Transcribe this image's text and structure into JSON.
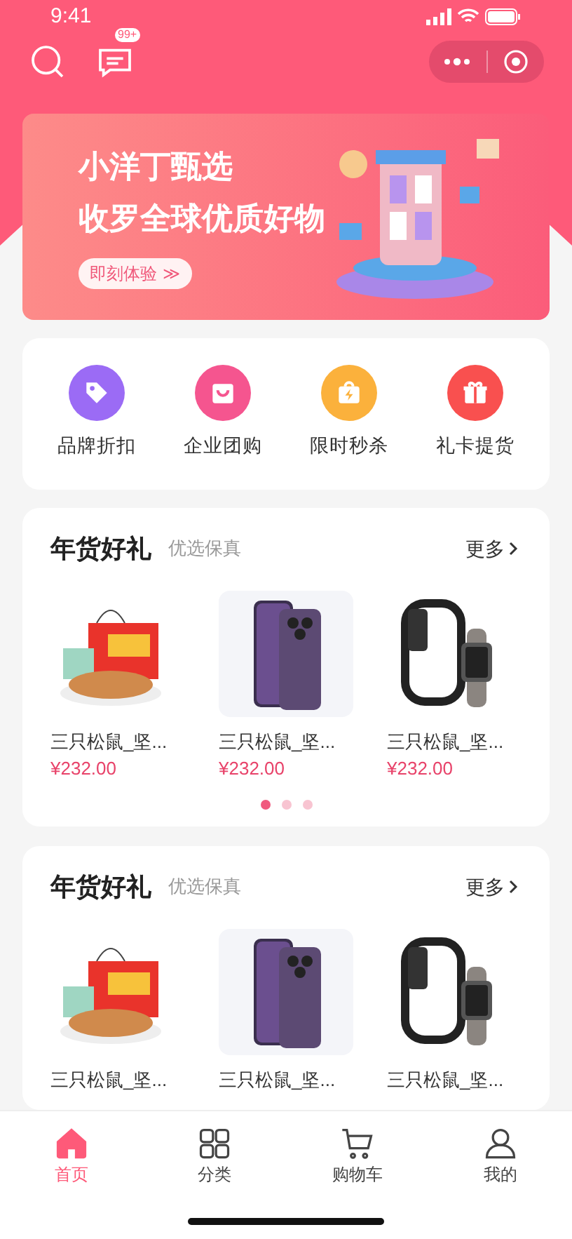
{
  "status_bar": {
    "time": "9:41"
  },
  "header": {
    "message_badge": "99+"
  },
  "banner": {
    "title": "小洋丁甄选",
    "subtitle": "收罗全球优质好物",
    "button": "即刻体验",
    "button_icon": "≫"
  },
  "shortcuts": [
    {
      "label": "品牌折扣",
      "kind": "tag",
      "color": "#9b6bf5"
    },
    {
      "label": "企业团购",
      "kind": "bag",
      "color": "#f5558f"
    },
    {
      "label": "限时秒杀",
      "kind": "flash",
      "color": "#fbb13c"
    },
    {
      "label": "礼卡提货",
      "kind": "gift",
      "color": "#f9504f"
    }
  ],
  "sections": [
    {
      "title": "年货好礼",
      "subtitle": "优选保真",
      "more": "更多",
      "products": [
        {
          "kind": "snacks",
          "name": "三只松鼠_坚...",
          "price": "¥232.00"
        },
        {
          "kind": "phone",
          "name": "三只松鼠_坚...",
          "price": "¥232.00"
        },
        {
          "kind": "watch",
          "name": "三只松鼠_坚...",
          "price": "¥232.00"
        }
      ],
      "pages": [
        {
          "selected": true
        },
        {
          "selected": false
        },
        {
          "selected": false
        }
      ]
    },
    {
      "title": "年货好礼",
      "subtitle": "优选保真",
      "more": "更多",
      "products": [
        {
          "kind": "snacks",
          "name": "三只松鼠_坚..."
        },
        {
          "kind": "phone",
          "name": "三只松鼠_坚..."
        },
        {
          "kind": "watch",
          "name": "三只松鼠_坚..."
        }
      ]
    }
  ],
  "tab_bar": [
    {
      "label": "首页",
      "kind": "home",
      "selected": true
    },
    {
      "label": "分类",
      "kind": "grid",
      "selected": false
    },
    {
      "label": "购物车",
      "kind": "cart",
      "selected": false
    },
    {
      "label": "我的",
      "kind": "user",
      "selected": false
    }
  ]
}
